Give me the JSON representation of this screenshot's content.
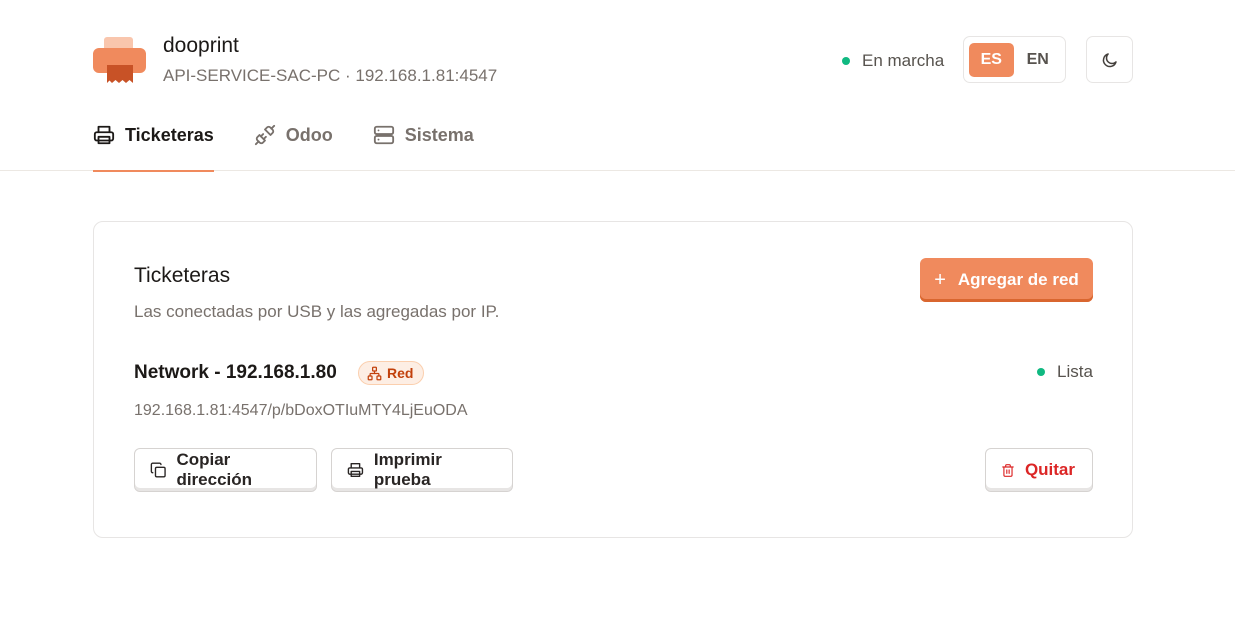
{
  "app": {
    "name": "dooprint",
    "subtitle": "API-SERVICE-SAC-PC · 192.168.1.81:4547"
  },
  "status": {
    "label": "En marcha",
    "color": "#10b981"
  },
  "language": {
    "options": [
      "ES",
      "EN"
    ],
    "selected": "ES"
  },
  "theme_toggle": {
    "icon": "moon-icon"
  },
  "tabs": [
    {
      "label": "Ticketeras",
      "icon": "printer-icon",
      "active": true
    },
    {
      "label": "Odoo",
      "icon": "plug-icon",
      "active": false
    },
    {
      "label": "Sistema",
      "icon": "server-icon",
      "active": false
    }
  ],
  "card": {
    "title": "Ticketeras",
    "description": "Las conectadas por USB y las agregadas por IP.",
    "add_button": "Agregar de red",
    "printer": {
      "name": "Network - 192.168.1.80",
      "badge": "Red",
      "status": "Lista",
      "url": "192.168.1.81:4547/p/bDoxOTIuMTY4LjEuODA"
    },
    "actions": {
      "copy": "Copiar dirección",
      "test": "Imprimir prueba",
      "remove": "Quitar"
    }
  },
  "colors": {
    "accent": "#f08a5d",
    "success": "#10b981",
    "danger": "#dc2626"
  }
}
